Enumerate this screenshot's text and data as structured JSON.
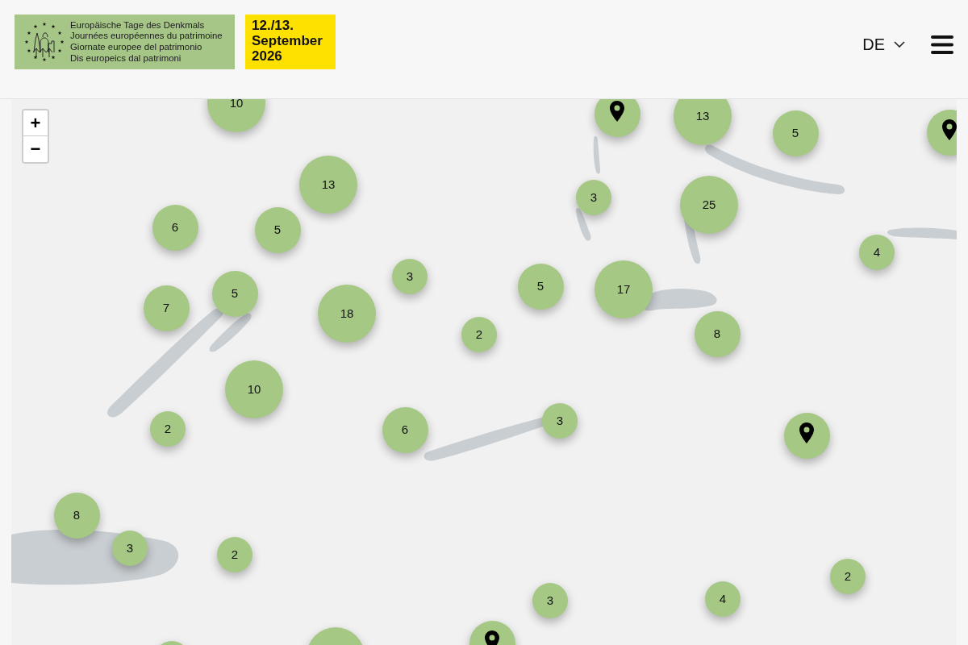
{
  "header": {
    "logo": {
      "lines": [
        "Europäische Tage des Denkmals",
        "Journées européennes du patrimoine",
        "Giornate europee del patrimonio",
        "Dis europeics dal patrimoni"
      ]
    },
    "date_badge": {
      "lines": [
        "12./13.",
        "September",
        "2026"
      ]
    },
    "language": {
      "label": "DE"
    }
  },
  "map": {
    "zoom_controls": {
      "zoom_in": "+",
      "zoom_out": "−"
    },
    "markers": [
      {
        "kind": "large",
        "count": "10"
      },
      {
        "kind": "pin"
      },
      {
        "kind": "large",
        "count": "13"
      },
      {
        "kind": "medium",
        "count": "5"
      },
      {
        "kind": "pin"
      },
      {
        "kind": "large",
        "count": "13"
      },
      {
        "kind": "small",
        "count": "3"
      },
      {
        "kind": "large",
        "count": "25"
      },
      {
        "kind": "medium",
        "count": "6"
      },
      {
        "kind": "medium",
        "count": "5"
      },
      {
        "kind": "small",
        "count": "4"
      },
      {
        "kind": "medium",
        "count": "7"
      },
      {
        "kind": "medium",
        "count": "5"
      },
      {
        "kind": "large",
        "count": "18"
      },
      {
        "kind": "small",
        "count": "3"
      },
      {
        "kind": "medium",
        "count": "5"
      },
      {
        "kind": "large",
        "count": "17"
      },
      {
        "kind": "small",
        "count": "2"
      },
      {
        "kind": "medium",
        "count": "8"
      },
      {
        "kind": "large",
        "count": "10"
      },
      {
        "kind": "small",
        "count": "2"
      },
      {
        "kind": "medium",
        "count": "6"
      },
      {
        "kind": "small",
        "count": "3"
      },
      {
        "kind": "pin"
      },
      {
        "kind": "medium",
        "count": "8"
      },
      {
        "kind": "small",
        "count": "3"
      },
      {
        "kind": "small",
        "count": "2"
      },
      {
        "kind": "small",
        "count": "3"
      },
      {
        "kind": "small",
        "count": "4"
      },
      {
        "kind": "small",
        "count": "2"
      },
      {
        "kind": "small"
      },
      {
        "kind": "large"
      },
      {
        "kind": "pin"
      }
    ]
  }
}
